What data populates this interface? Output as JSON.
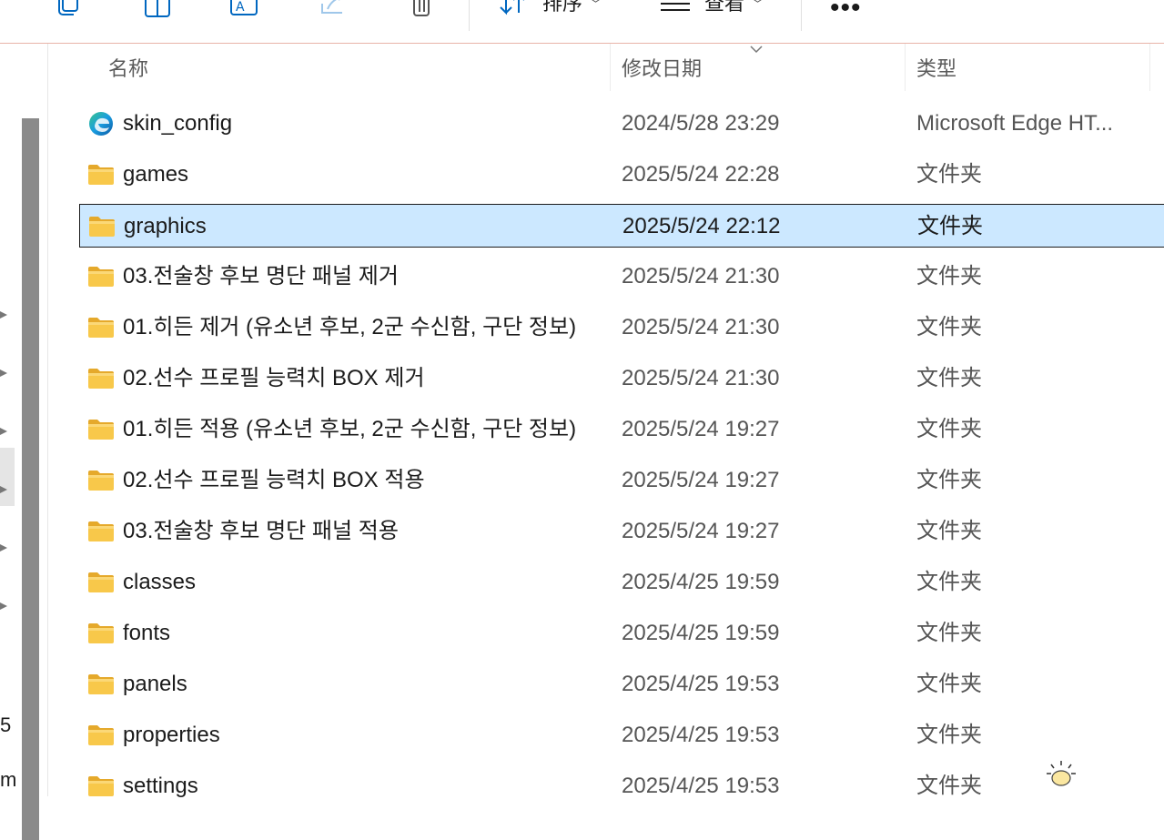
{
  "toolbar": {
    "sort_label": "排序",
    "view_label": "查看",
    "more_label": "•••",
    "icons": [
      "copy-icon",
      "paste-icon",
      "rename-icon",
      "share-icon",
      "delete-icon",
      "sort-icon",
      "view-icon",
      "more-icon"
    ]
  },
  "nav": {
    "fragments": [
      "5",
      "m"
    ]
  },
  "columns": {
    "name": "名称",
    "date": "修改日期",
    "type": "类型"
  },
  "files": [
    {
      "name": "skin_config",
      "date": "2024/5/28 23:29",
      "type": "Microsoft Edge HT...",
      "icon": "edge-html-icon",
      "selected": false
    },
    {
      "name": "games",
      "date": "2025/5/24 22:28",
      "type": "文件夹",
      "icon": "folder-icon",
      "selected": false
    },
    {
      "name": "graphics",
      "date": "2025/5/24 22:12",
      "type": "文件夹",
      "icon": "folder-icon",
      "selected": true
    },
    {
      "name": "03.전술창 후보 명단 패널 제거",
      "date": "2025/5/24 21:30",
      "type": "文件夹",
      "icon": "folder-icon",
      "selected": false
    },
    {
      "name": "01.히든 제거 (유소년 후보, 2군 수신함, 구단 정보)",
      "date": "2025/5/24 21:30",
      "type": "文件夹",
      "icon": "folder-icon",
      "selected": false
    },
    {
      "name": "02.선수 프로필 능력치 BOX 제거",
      "date": "2025/5/24 21:30",
      "type": "文件夹",
      "icon": "folder-icon",
      "selected": false
    },
    {
      "name": "01.히든 적용 (유소년 후보, 2군 수신함, 구단 정보)",
      "date": "2025/5/24 19:27",
      "type": "文件夹",
      "icon": "folder-icon",
      "selected": false
    },
    {
      "name": "02.선수 프로필 능력치 BOX 적용",
      "date": "2025/5/24 19:27",
      "type": "文件夹",
      "icon": "folder-icon",
      "selected": false
    },
    {
      "name": "03.전술창 후보 명단 패널 적용",
      "date": "2025/5/24 19:27",
      "type": "文件夹",
      "icon": "folder-icon",
      "selected": false
    },
    {
      "name": "classes",
      "date": "2025/4/25 19:59",
      "type": "文件夹",
      "icon": "folder-icon",
      "selected": false
    },
    {
      "name": "fonts",
      "date": "2025/4/25 19:59",
      "type": "文件夹",
      "icon": "folder-icon",
      "selected": false
    },
    {
      "name": "panels",
      "date": "2025/4/25 19:53",
      "type": "文件夹",
      "icon": "folder-icon",
      "selected": false
    },
    {
      "name": "properties",
      "date": "2025/4/25 19:53",
      "type": "文件夹",
      "icon": "folder-icon",
      "selected": false
    },
    {
      "name": "settings",
      "date": "2025/4/25 19:53",
      "type": "文件夹",
      "icon": "folder-icon",
      "selected": false
    }
  ],
  "colors": {
    "selection_bg": "#cce8ff",
    "folder": "#f8c84a",
    "accent": "#0067c0"
  }
}
